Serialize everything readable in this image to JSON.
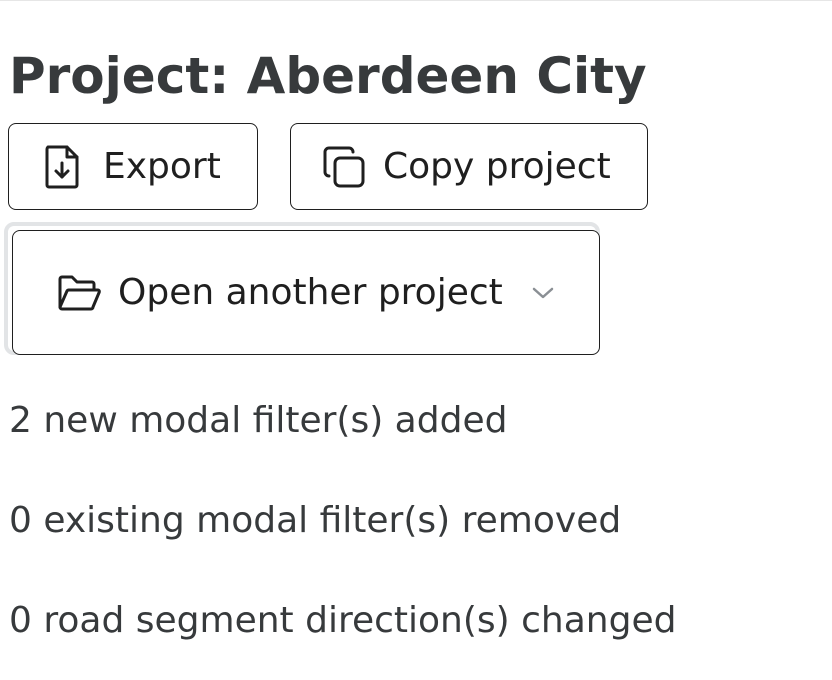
{
  "project": {
    "title": "Project: Aberdeen City"
  },
  "toolbar": {
    "export_label": "Export",
    "copy_label": "Copy project",
    "open_label": "Open another project"
  },
  "icons": {
    "export": "file-download-icon",
    "copy": "copy-icon",
    "open": "folder-open-icon",
    "dropdown": "chevron-down-icon"
  },
  "changes": [
    "2 new modal filter(s) added",
    "0 existing modal filter(s) removed",
    "0 road segment direction(s) changed"
  ],
  "colors": {
    "text": "#373a3c",
    "border": "#1f1f1f",
    "focus_ring": "#e2e4e6",
    "chevron": "#8a8f94"
  }
}
